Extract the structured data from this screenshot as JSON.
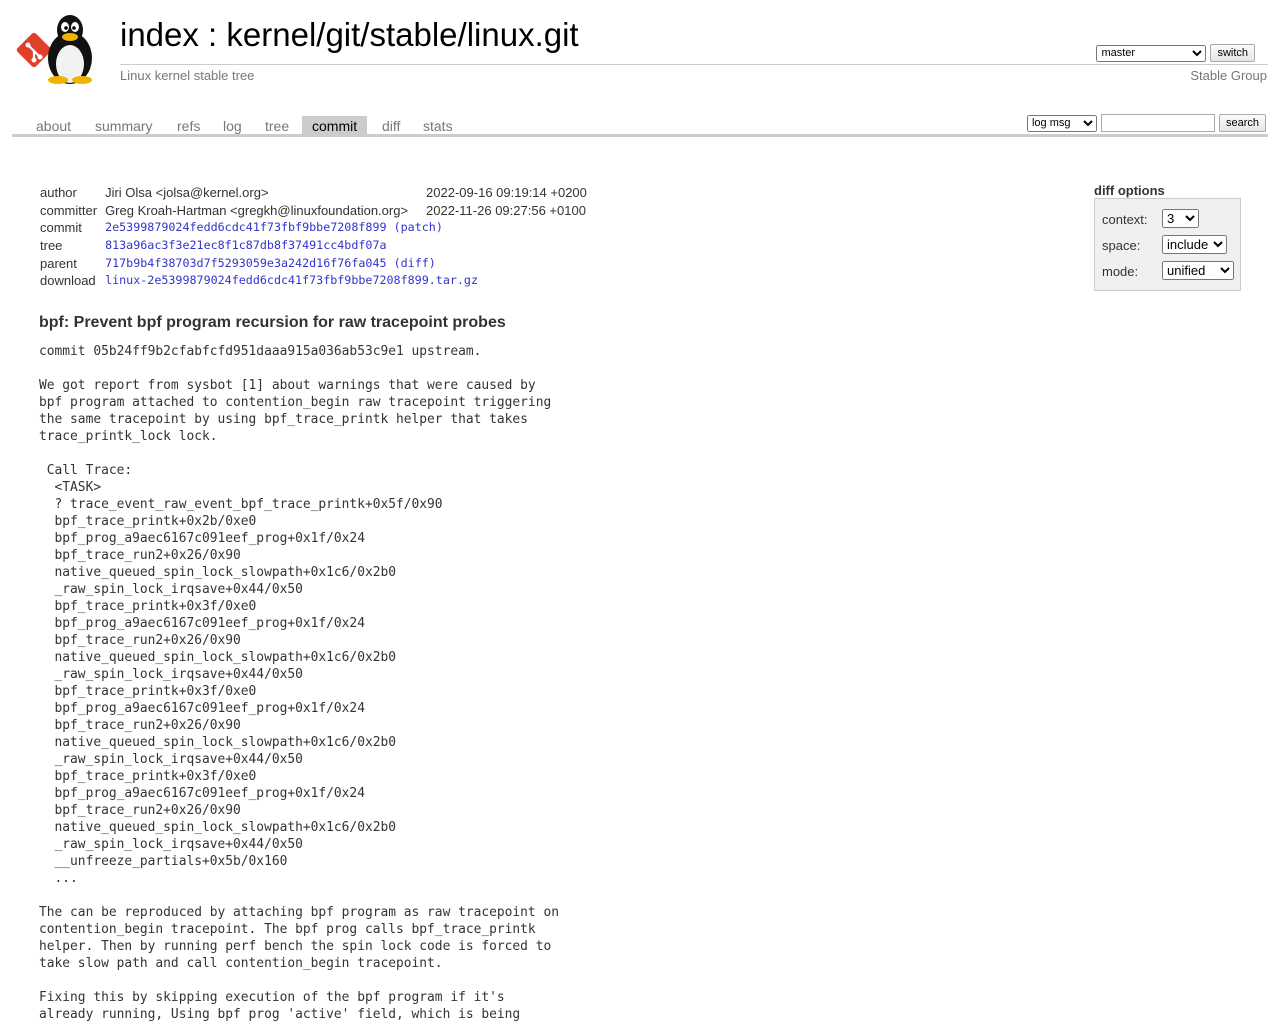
{
  "header": {
    "title_index": "index",
    "title_sep": " : ",
    "title_repo": "kernel/git/stable/linux.git",
    "subtitle": "Linux kernel stable tree",
    "owner": "Stable Group",
    "branch_selected": "master",
    "switch_label": "switch"
  },
  "tabs": [
    {
      "label": "about"
    },
    {
      "label": "summary"
    },
    {
      "label": "refs"
    },
    {
      "label": "log"
    },
    {
      "label": "tree"
    },
    {
      "label": "commit"
    },
    {
      "label": "diff"
    },
    {
      "label": "stats"
    }
  ],
  "active_tab": "commit",
  "search": {
    "mode_selected": "log msg",
    "value": "",
    "button_label": "search"
  },
  "commit_info": {
    "author_label": "author",
    "author": "Jiri Olsa <jolsa@kernel.org>",
    "author_date": "2022-09-16 09:19:14 +0200",
    "committer_label": "committer",
    "committer": "Greg Kroah-Hartman <gregkh@linuxfoundation.org>",
    "committer_date": "2022-11-26 09:27:56 +0100",
    "commit_label": "commit",
    "commit_hash": "2e5399879024fedd6cdc41f73fbf9bbe7208f899",
    "patch_link": "patch",
    "tree_label": "tree",
    "tree_hash": "813a96ac3f3e21ec8f1c87db8f37491cc4bdf07a",
    "parent_label": "parent",
    "parent_hash": "717b9b4f38703d7f5293059e3a242d16f76fa045",
    "diff_link": "diff",
    "download_label": "download",
    "download_file": "linux-2e5399879024fedd6cdc41f73fbf9bbe7208f899.tar.gz"
  },
  "diff_options": {
    "title": "diff options",
    "context_label": "context:",
    "context_value": "3",
    "space_label": "space:",
    "space_value": "include",
    "mode_label": "mode:",
    "mode_value": "unified"
  },
  "subject": "bpf: Prevent bpf program recursion for raw tracepoint probes",
  "message": "commit 05b24ff9b2cfabfcfd951daaa915a036ab53c9e1 upstream.\n\nWe got report from sysbot [1] about warnings that were caused by\nbpf program attached to contention_begin raw tracepoint triggering\nthe same tracepoint by using bpf_trace_printk helper that takes\ntrace_printk_lock lock.\n\n Call Trace:\n  <TASK>\n  ? trace_event_raw_event_bpf_trace_printk+0x5f/0x90\n  bpf_trace_printk+0x2b/0xe0\n  bpf_prog_a9aec6167c091eef_prog+0x1f/0x24\n  bpf_trace_run2+0x26/0x90\n  native_queued_spin_lock_slowpath+0x1c6/0x2b0\n  _raw_spin_lock_irqsave+0x44/0x50\n  bpf_trace_printk+0x3f/0xe0\n  bpf_prog_a9aec6167c091eef_prog+0x1f/0x24\n  bpf_trace_run2+0x26/0x90\n  native_queued_spin_lock_slowpath+0x1c6/0x2b0\n  _raw_spin_lock_irqsave+0x44/0x50\n  bpf_trace_printk+0x3f/0xe0\n  bpf_prog_a9aec6167c091eef_prog+0x1f/0x24\n  bpf_trace_run2+0x26/0x90\n  native_queued_spin_lock_slowpath+0x1c6/0x2b0\n  _raw_spin_lock_irqsave+0x44/0x50\n  bpf_trace_printk+0x3f/0xe0\n  bpf_prog_a9aec6167c091eef_prog+0x1f/0x24\n  bpf_trace_run2+0x26/0x90\n  native_queued_spin_lock_slowpath+0x1c6/0x2b0\n  _raw_spin_lock_irqsave+0x44/0x50\n  __unfreeze_partials+0x5b/0x160\n  ...\n\nThe can be reproduced by attaching bpf program as raw tracepoint on\ncontention_begin tracepoint. The bpf prog calls bpf_trace_printk\nhelper. Then by running perf bench the spin lock code is forced to\ntake slow path and call contention_begin tracepoint.\n\nFixing this by skipping execution of the bpf program if it's\nalready running, Using bpf prog 'active' field, which is being",
  "colors": {
    "link": "#3333cc",
    "tab_active_bg": "#cccccc",
    "options_bg": "#f0f0f0",
    "git_logo": "#e0402a"
  },
  "icons": {
    "logo": "tux-penguin-with-git-logo"
  }
}
